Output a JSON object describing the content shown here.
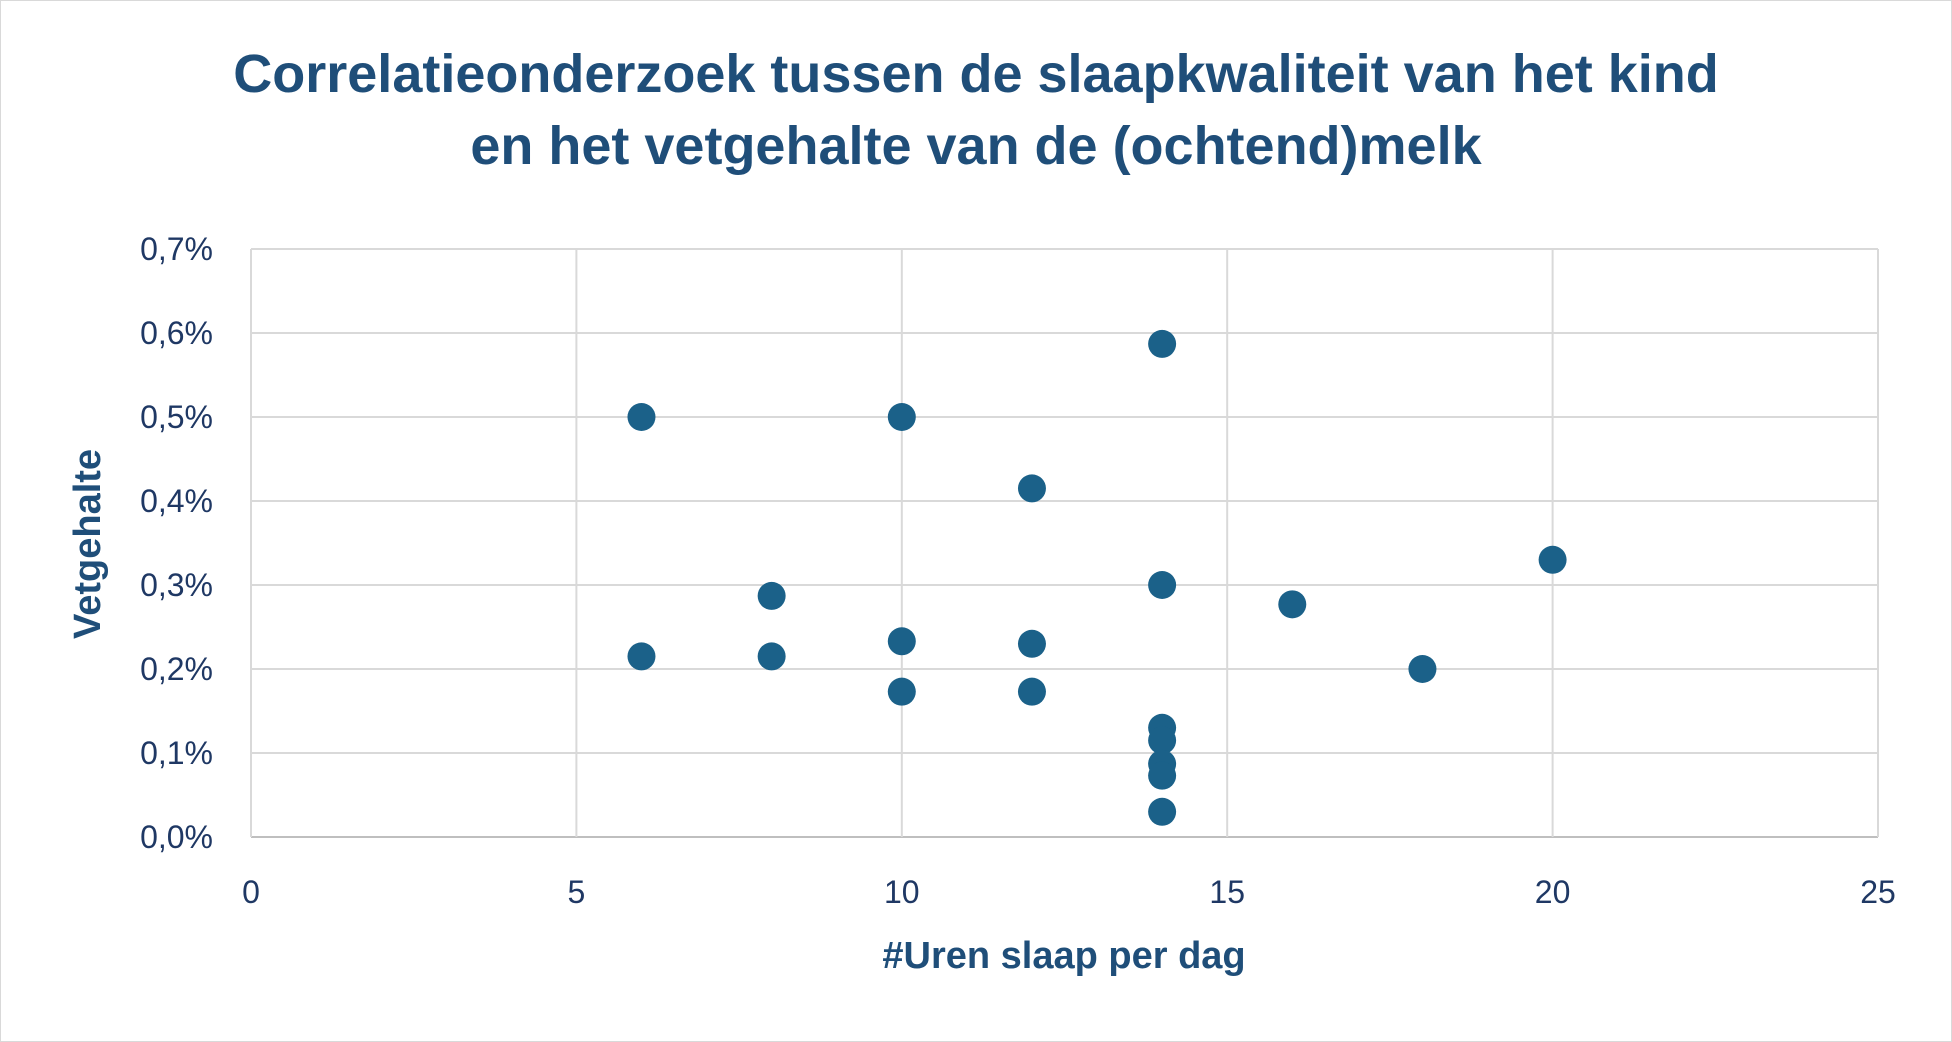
{
  "chart_data": {
    "type": "scatter",
    "title_lines": [
      "Correlatieonderzoek tussen de slaapkwaliteit van het kind",
      "en het vetgehalte van de (ochtend)melk"
    ],
    "xlabel": "#Uren slaap per dag",
    "ylabel": "Vetgehalte",
    "xlim": [
      0,
      25
    ],
    "ylim": [
      0,
      0.7
    ],
    "x_ticks": [
      0,
      5,
      10,
      15,
      20,
      25
    ],
    "x_tick_labels": [
      "0",
      "5",
      "10",
      "15",
      "20",
      "25"
    ],
    "y_ticks": [
      0,
      0.1,
      0.2,
      0.3,
      0.4,
      0.5,
      0.6,
      0.7
    ],
    "y_tick_labels": [
      "0,0%",
      "0,1%",
      "0,2%",
      "0,3%",
      "0,4%",
      "0,5%",
      "0,6%",
      "0,7%"
    ],
    "grid": true,
    "legend": "none",
    "marker_color": "#1b6189",
    "points": [
      {
        "x": 6,
        "y": 0.5
      },
      {
        "x": 6,
        "y": 0.215
      },
      {
        "x": 8,
        "y": 0.287
      },
      {
        "x": 8,
        "y": 0.215
      },
      {
        "x": 10,
        "y": 0.5
      },
      {
        "x": 10,
        "y": 0.233
      },
      {
        "x": 10,
        "y": 0.173
      },
      {
        "x": 12,
        "y": 0.415
      },
      {
        "x": 12,
        "y": 0.23
      },
      {
        "x": 12,
        "y": 0.173
      },
      {
        "x": 14,
        "y": 0.587
      },
      {
        "x": 14,
        "y": 0.3
      },
      {
        "x": 14,
        "y": 0.13
      },
      {
        "x": 14,
        "y": 0.115
      },
      {
        "x": 14,
        "y": 0.087
      },
      {
        "x": 14,
        "y": 0.073
      },
      {
        "x": 14,
        "y": 0.03
      },
      {
        "x": 16,
        "y": 0.277
      },
      {
        "x": 18,
        "y": 0.2
      },
      {
        "x": 20,
        "y": 0.33
      }
    ]
  }
}
